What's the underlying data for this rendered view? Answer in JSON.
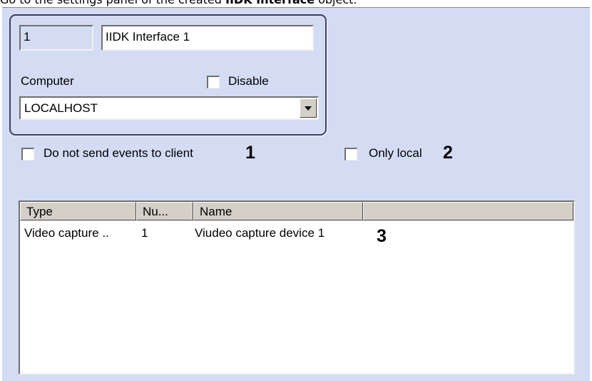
{
  "instruction": {
    "prefix": "Go to the settings panel of the created ",
    "bold": "IIDK Interface",
    "suffix": " object."
  },
  "object": {
    "id": "1",
    "name": "IIDK Interface 1"
  },
  "computer": {
    "label": "Computer",
    "selected": "LOCALHOST"
  },
  "disable": {
    "label": "Disable",
    "checked": false
  },
  "do_not_send_events": {
    "label": "Do not send events to client",
    "checked": false
  },
  "only_local": {
    "label": "Only local",
    "checked": false
  },
  "markers": {
    "m1": "1",
    "m2": "2",
    "m3": "3"
  },
  "table": {
    "columns": [
      "Type",
      "Nu...",
      "Name",
      ""
    ],
    "rows": [
      [
        "Video capture ..",
        "1",
        "Viudeo capture device 1"
      ]
    ]
  },
  "icons": {
    "dropdown": "chevron-down-icon"
  },
  "colors": {
    "panel_background": "#d4dcf4",
    "group_border": "#3b3f63",
    "header_background": "#d4d0c8"
  }
}
